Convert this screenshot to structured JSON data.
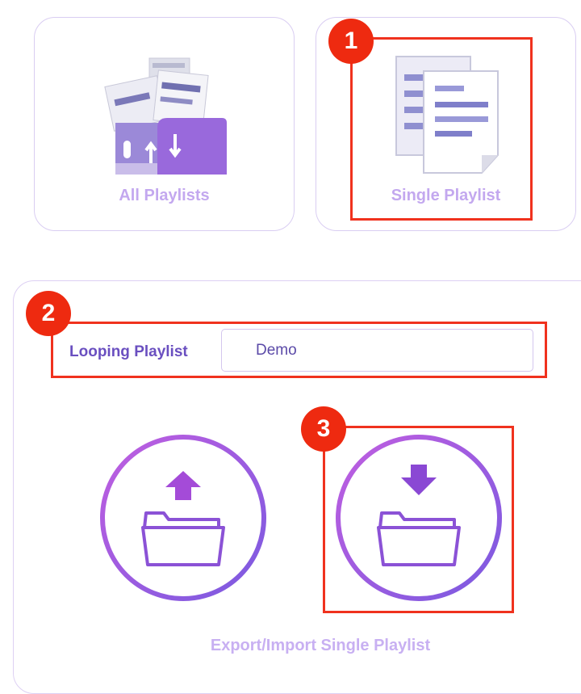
{
  "cards": {
    "all_playlists": {
      "label": "All Playlists"
    },
    "single_playlist": {
      "label": "Single Playlist"
    }
  },
  "badges": {
    "one": "1",
    "two": "2",
    "three": "3"
  },
  "looping": {
    "label": "Looping Playlist",
    "value": "Demo"
  },
  "panel": {
    "caption": "Export/Import Single Playlist"
  },
  "icons": {
    "all_playlists": "folder-with-documents-icon",
    "single_playlist": "documents-icon",
    "export": "folder-export-icon",
    "import": "folder-import-icon"
  },
  "colors": {
    "accent": "#9b5fe0",
    "highlight": "#f0321e",
    "label": "#c3a8ef"
  }
}
